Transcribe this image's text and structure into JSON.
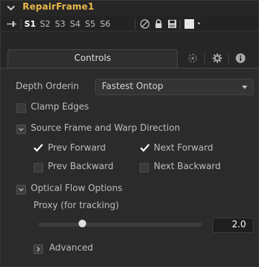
{
  "tool": {
    "name": "RepairFrame1"
  },
  "versions": {
    "items": [
      "S1",
      "S2",
      "S3",
      "S4",
      "S5",
      "S6"
    ],
    "active": "S1"
  },
  "tabs": {
    "controls_label": "Controls"
  },
  "depth": {
    "label": "Depth Orderin",
    "value": "Fastest Ontop"
  },
  "clamp": {
    "label": "Clamp Edges",
    "checked": false
  },
  "source": {
    "label": "Source Frame and Warp Direction",
    "prev_forward": {
      "label": "Prev Forward",
      "checked": true
    },
    "next_forward": {
      "label": "Next Forward",
      "checked": true
    },
    "prev_backward": {
      "label": "Prev Backward",
      "checked": false
    },
    "next_backward": {
      "label": "Next Backward",
      "checked": false
    }
  },
  "optical": {
    "label": "Optical Flow Options",
    "proxy_label": "Proxy (for tracking)",
    "proxy_value": "2.0",
    "advanced_label": "Advanced"
  }
}
